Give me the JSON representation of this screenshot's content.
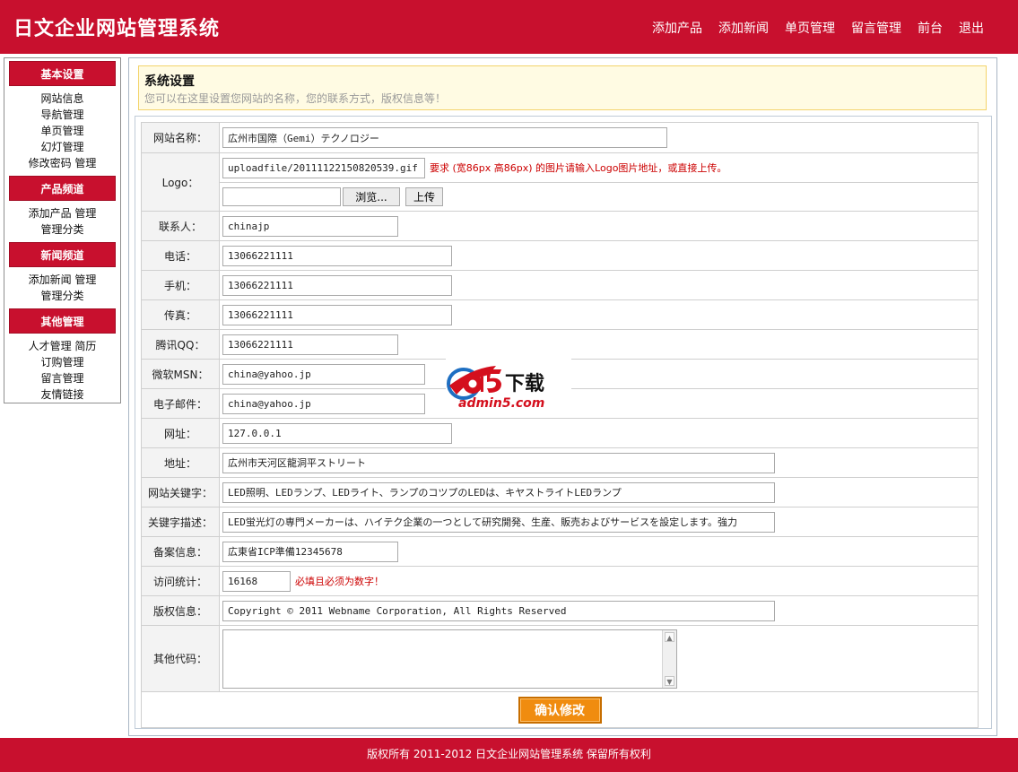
{
  "header": {
    "title": "日文企业网站管理系统",
    "nav": [
      "添加产品",
      "添加新闻",
      "单页管理",
      "留言管理",
      "前台",
      "退出"
    ]
  },
  "sidebar": {
    "groups": [
      {
        "title": "基本设置",
        "lines": [
          [
            "网站信息"
          ],
          [
            "导航管理"
          ],
          [
            "单页管理"
          ],
          [
            "幻灯管理"
          ],
          [
            "修改密码",
            "管理"
          ]
        ]
      },
      {
        "title": "产品频道",
        "lines": [
          [
            "添加产品",
            "管理"
          ],
          [
            "管理分类"
          ]
        ]
      },
      {
        "title": "新闻频道",
        "lines": [
          [
            "添加新闻",
            "管理"
          ],
          [
            "管理分类"
          ]
        ]
      },
      {
        "title": "其他管理",
        "lines": [
          [
            "人才管理",
            "简历"
          ],
          [
            "订购管理"
          ],
          [
            "留言管理"
          ],
          [
            "友情链接"
          ]
        ]
      }
    ]
  },
  "notice": {
    "title": "系统设置",
    "desc": "您可以在这里设置您网站的名称，您的联系方式，版权信息等！"
  },
  "form": {
    "site_name": {
      "label": "网站名称：",
      "value": "広州市国際（Gemi）テクノロジー"
    },
    "logo": {
      "label": "Logo：",
      "value": "uploadfile/20111122150820539.gif",
      "hint": "要求 (宽86px 高86px) 的图片请输入Logo图片地址，或直接上传。",
      "browse_label": "浏览...",
      "upload_label": "上传",
      "file_value": ""
    },
    "contact": {
      "label": "联系人：",
      "value": "chinajp"
    },
    "phone": {
      "label": "电话：",
      "value": "13066221111"
    },
    "mobile": {
      "label": "手机：",
      "value": "13066221111"
    },
    "fax": {
      "label": "传真：",
      "value": "13066221111"
    },
    "qq": {
      "label": "腾讯QQ：",
      "value": "13066221111"
    },
    "msn": {
      "label": "微软MSN：",
      "value": "china@yahoo.jp"
    },
    "email": {
      "label": "电子邮件：",
      "value": "china@yahoo.jp"
    },
    "url": {
      "label": "网址：",
      "value": "127.0.0.1"
    },
    "address": {
      "label": "地址：",
      "value": "広州市天河区龍洞平ストリート"
    },
    "keywords": {
      "label": "网站关键字：",
      "value": "LED照明、LEDランプ、LEDライト、ランプのコツプのLEDは、キヤストライトLEDランプ"
    },
    "description": {
      "label": "关键字描述：",
      "value": "LED蛍光灯の専門メーカーは、ハイテク企業の一つとして研究開発、生産、販売およびサービスを設定します。強力"
    },
    "icp": {
      "label": "备案信息：",
      "value": "広東省ICP準備12345678"
    },
    "stats": {
      "label": "访问统计：",
      "value": "16168",
      "hint": "必填且必须为数字！"
    },
    "copyright": {
      "label": "版权信息：",
      "value": "Copyright © 2011 Webname Corporation, All Rights Reserved"
    },
    "other_code": {
      "label": "其他代码：",
      "value": ""
    },
    "submit_label": "确认修改"
  },
  "watermark": {
    "brand": "a5",
    "chars": "下载",
    "domain": "admin5.com"
  },
  "footer": {
    "text": "版权所有 2011-2012 日文企业网站管理系统 保留所有权利"
  },
  "colors": {
    "brand_red": "#c8102e",
    "submit_orange": "#f08c0f",
    "hint_red": "#cc0000"
  }
}
